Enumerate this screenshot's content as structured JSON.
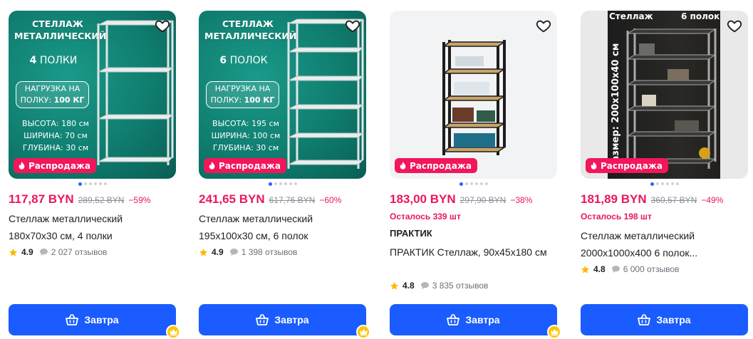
{
  "products": [
    {
      "price": "117,87 BYN",
      "old_price": "289,52 BYN",
      "discount": "−59%",
      "title": "Стеллаж металлический 180x70x30 см, 4 полки",
      "rating": "4.9",
      "reviews": "2 027 отзывов",
      "sale_label": "Распродажа",
      "button_label": "Завтра",
      "image_text": {
        "title": "СТЕЛЛАЖ МЕТАЛЛИЧЕСКИЙ",
        "count_num": "4",
        "count_word": "ПОЛКИ",
        "load_line1": "НАГРУЗКА НА",
        "load_line2": "ПОЛКУ:",
        "load_value": "100 КГ",
        "height": "ВЫСОТА: 180 см",
        "width": "ШИРИНА: 70 см",
        "depth": "ГЛУБИНА: 30 см"
      },
      "active_dot": 0,
      "dot_count": 6
    },
    {
      "price": "241,65 BYN",
      "old_price": "617,76 BYN",
      "discount": "−60%",
      "title": "Стеллаж металлический 195x100x30 см, 6 полок",
      "rating": "4.9",
      "reviews": "1 398 отзывов",
      "sale_label": "Распродажа",
      "button_label": "Завтра",
      "image_text": {
        "title": "СТЕЛЛАЖ МЕТАЛЛИЧЕСКИЙ",
        "count_num": "6",
        "count_word": "ПОЛОК",
        "load_line1": "НАГРУЗКА НА",
        "load_line2": "ПОЛКУ:",
        "load_value": "100 КГ",
        "height": "ВЫСОТА: 195 см",
        "width": "ШИРИНА: 100 см",
        "depth": "ГЛУБИНА: 30 см"
      },
      "active_dot": 0,
      "dot_count": 6
    },
    {
      "price": "183,00 BYN",
      "old_price": "297,90 BYN",
      "discount": "−38%",
      "stock_left": "Осталось 339 шт",
      "brand": "ПРАКТИК",
      "title": "ПРАКТИК Стеллаж, 90x45x180 см",
      "rating": "4.8",
      "reviews": "3 835 отзывов",
      "sale_label": "Распродажа",
      "button_label": "Завтра",
      "active_dot": 0,
      "dot_count": 6
    },
    {
      "price": "181,89 BYN",
      "old_price": "360,57 BYN",
      "discount": "−49%",
      "stock_left": "Осталось 198 шт",
      "title": "Стеллаж металлический 2000x1000x400 6 полок...",
      "rating": "4.8",
      "reviews": "6 000 отзывов",
      "sale_label": "Распродажа",
      "button_label": "Завтра",
      "image_text": {
        "title": "Стеллаж",
        "shelves": "6 полок",
        "size": "Размер: 200x100x40 см"
      },
      "active_dot": 0,
      "dot_count": 6
    }
  ],
  "colors": {
    "accent_pink": "#e8185c",
    "button_blue": "#1a5cff",
    "star": "#ffb800",
    "crown_badge": "#ffc400"
  },
  "icons": [
    "heart-icon",
    "fire-icon",
    "star-icon",
    "review-bubble-icon",
    "basket-icon",
    "crown-icon"
  ]
}
